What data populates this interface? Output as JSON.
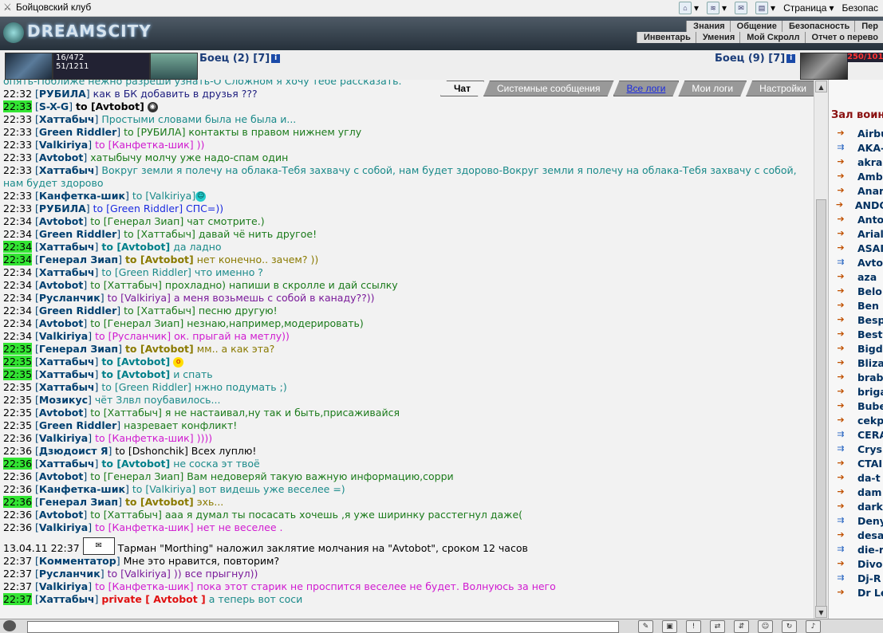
{
  "browser": {
    "title": "Бойцовский клуб",
    "toolbar": {
      "page_label": "Страница",
      "safety_label": "Безопас"
    }
  },
  "header": {
    "logo": "DREAMSCITY",
    "menu_top": [
      "Знания",
      "Общение",
      "Безопасность",
      "Пер"
    ],
    "menu_bottom": [
      "Инвентарь",
      "Умения",
      "Мой Скролл",
      "Отчет о перево"
    ]
  },
  "fight": {
    "my_hp": "16/472",
    "my_mana": "51/1211",
    "left_fighter": "Боец (2) [7]",
    "right_fighter": "Боец (9) [7]",
    "enemy_hp": "250/101"
  },
  "tabs": [
    "Чат",
    "Системные сообщения",
    "Все логи",
    "Мои логи",
    "Настройки"
  ],
  "colors": {
    "highlight_time": "#33e533",
    "nick": "#004070",
    "to": "#00808a",
    "teal": "#1a8a8a",
    "green": "#1a7a1a",
    "blue": "#1a2ae0",
    "magenta": "#d01ad0",
    "olive": "#8a7a00",
    "purple": "#7a1a9a",
    "black": "#000000",
    "navy": "#202080",
    "red": "#e01010"
  },
  "messages": [
    {
      "time": "",
      "nick": "",
      "to": "",
      "text": "опять-Поближе нежно разреши узнать-О Сложном я хочу тебе рассказать.",
      "color": "teal"
    },
    {
      "time": "22:32",
      "hl": false,
      "nick": "РУБИЛА",
      "to": "",
      "text": "как в БК добавить в друзья ???",
      "color": "navy"
    },
    {
      "time": "22:33",
      "hl": true,
      "nick": "S-X-G",
      "to": "to [Avtobot]",
      "to_black": true,
      "text": "",
      "color": "black",
      "emo": "alien"
    },
    {
      "time": "22:33",
      "hl": false,
      "nick": "Хаттабыч",
      "to": "",
      "text": "Простыми словами была не была и...",
      "color": "teal"
    },
    {
      "time": "22:33",
      "hl": false,
      "nick": "Green Riddler",
      "to": "",
      "text": "to [РУБИЛА] контакты в правом нижнем углу",
      "color": "green"
    },
    {
      "time": "22:33",
      "hl": false,
      "nick": "Valkiriya",
      "to": "",
      "text": "to [Канфетка-шик] ))",
      "color": "magenta"
    },
    {
      "time": "22:33",
      "hl": false,
      "nick": "Avtobot",
      "to": "",
      "text": "хатыбычу молчу уже надо-спам один",
      "color": "green"
    },
    {
      "time": "22:33",
      "hl": false,
      "nick": "Хаттабыч",
      "to": "",
      "text": "Вокруг земли я полечу на облака-Тебя захвачу с собой, нам будет здорово-Вокруг земли я полечу на облака-Тебя захвачу с собой, нам будет здорово",
      "color": "teal",
      "wrap": true
    },
    {
      "time": "22:33",
      "hl": false,
      "nick": "Канфетка-шик",
      "to": "",
      "text": "to [Valkiriya]",
      "color": "teal",
      "emo": "smile"
    },
    {
      "time": "22:33",
      "hl": false,
      "nick": "РУБИЛА",
      "to": "",
      "text": "to [Green Riddler] СПС=))",
      "color": "blue"
    },
    {
      "time": "22:34",
      "hl": false,
      "nick": "Avtobot",
      "to": "",
      "text": "to [Генерал Зиап] чат смотрите.)",
      "color": "green"
    },
    {
      "time": "22:34",
      "hl": false,
      "nick": "Green Riddler",
      "to": "",
      "text": "to [Хаттабыч] давай чё нить другое!",
      "color": "green"
    },
    {
      "time": "22:34",
      "hl": true,
      "nick": "Хаттабыч",
      "to": "to [Avtobot]",
      "text": "да ладно",
      "color": "teal"
    },
    {
      "time": "22:34",
      "hl": true,
      "nick": "Генерал Зиап",
      "to": "to [Avtobot]",
      "to_olive": true,
      "text": "нет конечно.. зачем? ))",
      "color": "olive"
    },
    {
      "time": "22:34",
      "hl": false,
      "nick": "Хаттабыч",
      "to": "",
      "text": "to [Green Riddler] что именно ?",
      "color": "teal"
    },
    {
      "time": "22:34",
      "hl": false,
      "nick": "Avtobot",
      "to": "",
      "text": "to [Хаттабыч] прохладно) напиши в скролле и дай ссылку",
      "color": "green"
    },
    {
      "time": "22:34",
      "hl": false,
      "nick": "Русланчик",
      "to": "",
      "text": "to [Valkiriya] а меня возьмешь с собой в канаду??))",
      "color": "purple"
    },
    {
      "time": "22:34",
      "hl": false,
      "nick": "Green Riddler",
      "to": "",
      "text": "to [Хаттабыч] песню другую!",
      "color": "green"
    },
    {
      "time": "22:34",
      "hl": false,
      "nick": "Avtobot",
      "to": "",
      "text": "to [Генерал Зиап] незнаю,например,модерировать)",
      "color": "green"
    },
    {
      "time": "22:34",
      "hl": false,
      "nick": "Valkiriya",
      "to": "",
      "text": "to [Русланчик] ок. прыгай на метлу))",
      "color": "magenta"
    },
    {
      "time": "22:35",
      "hl": true,
      "nick": "Генерал Зиап",
      "to": "to [Avtobot]",
      "to_olive": true,
      "text": "мм.. а как эта?",
      "color": "olive"
    },
    {
      "time": "22:35",
      "hl": true,
      "nick": "Хаттабыч",
      "to": "to [Avtobot]",
      "text": "",
      "color": "teal",
      "emo": "wow"
    },
    {
      "time": "22:35",
      "hl": true,
      "nick": "Хаттабыч",
      "to": "to [Avtobot]",
      "text": "и спать",
      "color": "teal"
    },
    {
      "time": "22:35",
      "hl": false,
      "nick": "Хаттабыч",
      "to": "",
      "text": "to [Green Riddler] нжно подумать ;)",
      "color": "teal"
    },
    {
      "time": "22:35",
      "hl": false,
      "nick": "Мозикус",
      "to": "",
      "text": "чёт Злвл поубавилось...",
      "color": "teal"
    },
    {
      "time": "22:35",
      "hl": false,
      "nick": "Avtobot",
      "to": "",
      "text": "to [Хаттабыч] я не настаивал,ну так и быть,присаживайся",
      "color": "green"
    },
    {
      "time": "22:35",
      "hl": false,
      "nick": "Green Riddler",
      "to": "",
      "text": "назревает конфликт!",
      "color": "green"
    },
    {
      "time": "22:36",
      "hl": false,
      "nick": "Valkiriya",
      "to": "",
      "text": "to [Канфетка-шик] ))))",
      "color": "magenta"
    },
    {
      "time": "22:36",
      "hl": false,
      "nick": "Дзюдоист Я",
      "to": "",
      "text": "to [Dshonchik] Всех луплю!",
      "color": "black"
    },
    {
      "time": "22:36",
      "hl": true,
      "nick": "Хаттабыч",
      "to": "to [Avtobot]",
      "text": "не соска эт твоё",
      "color": "teal"
    },
    {
      "time": "22:36",
      "hl": false,
      "nick": "Avtobot",
      "to": "",
      "text": "to [Генерал Зиап] Вам недоверяй такую важную информацию,сорри",
      "color": "green"
    },
    {
      "time": "22:36",
      "hl": false,
      "nick": "Канфетка-шик",
      "to": "",
      "text": "to [Valkiriya] вот видешь уже веселее =)",
      "color": "teal"
    },
    {
      "time": "22:36",
      "hl": true,
      "nick": "Генерал Зиап",
      "to": "to [Avtobot]",
      "to_olive": true,
      "text": "эхь...",
      "color": "olive"
    },
    {
      "time": "22:36",
      "hl": false,
      "nick": "Avtobot",
      "to": "",
      "text": "to [Хаттабыч] ааа я думал ты посасать хочешь ,я уже ширинку расстегнул даже(",
      "color": "green"
    },
    {
      "time": "22:36",
      "hl": false,
      "nick": "Valkiriya",
      "to": "",
      "text": "to [Канфетка-шик] нет не веселее .",
      "color": "magenta"
    },
    {
      "system": true,
      "date": "13.04.11 22:37",
      "text": "Тарман \"Morthing\" наложил заклятие молчания на \"Avtobot\", сроком 12 часов"
    },
    {
      "time": "22:37",
      "hl": false,
      "nick": "Комментатор",
      "to": "",
      "text": "Мне это нравится, повторим?",
      "color": "black"
    },
    {
      "time": "22:37",
      "hl": false,
      "nick": "Русланчик",
      "to": "",
      "text": "to [Valkiriya] )) все прыгнул))",
      "color": "purple"
    },
    {
      "time": "22:37",
      "hl": false,
      "nick": "Valkiriya",
      "to": "",
      "text": "to [Канфетка-шик] пока этот старик не проспится веселее не будет. Волнуюсь за него",
      "color": "magenta"
    },
    {
      "time": "22:37",
      "hl": true,
      "nick": "Хаттабыч",
      "to": "private [ Avtobot ]",
      "to_red": true,
      "text": "а теперь вот соси",
      "color": "teal"
    }
  ],
  "room": {
    "title": "Зал воин",
    "users": [
      {
        "name": "Airbu",
        "icon": "o"
      },
      {
        "name": "AKA-",
        "icon": "b"
      },
      {
        "name": "akra",
        "icon": "o"
      },
      {
        "name": "Amb",
        "icon": "o"
      },
      {
        "name": "Anar",
        "icon": "o"
      },
      {
        "name": "ANDO",
        "icon": "o"
      },
      {
        "name": "Anto",
        "icon": "o"
      },
      {
        "name": "Arial",
        "icon": "o"
      },
      {
        "name": "ASAI",
        "icon": "o"
      },
      {
        "name": "Avto",
        "icon": "b"
      },
      {
        "name": "aza",
        "icon": "o"
      },
      {
        "name": "Belo",
        "icon": "o"
      },
      {
        "name": "Ben",
        "icon": "o"
      },
      {
        "name": "Besp",
        "icon": "o"
      },
      {
        "name": "Best",
        "icon": "o"
      },
      {
        "name": "Bigd",
        "icon": "o"
      },
      {
        "name": "Bliza",
        "icon": "o"
      },
      {
        "name": "brab",
        "icon": "o"
      },
      {
        "name": "briga",
        "icon": "o"
      },
      {
        "name": "Bube",
        "icon": "o"
      },
      {
        "name": "cekp",
        "icon": "o"
      },
      {
        "name": "CERA",
        "icon": "b"
      },
      {
        "name": "Crys",
        "icon": "b"
      },
      {
        "name": "CTAI",
        "icon": "o"
      },
      {
        "name": "da-t",
        "icon": "o"
      },
      {
        "name": "dam",
        "icon": "o"
      },
      {
        "name": "dark",
        "icon": "o"
      },
      {
        "name": "Deny",
        "icon": "b"
      },
      {
        "name": "desa",
        "icon": "o"
      },
      {
        "name": "die-r",
        "icon": "b"
      },
      {
        "name": "Divo",
        "icon": "o"
      },
      {
        "name": "Dj-R",
        "icon": "b"
      },
      {
        "name": "Dr Le",
        "icon": "o"
      }
    ]
  }
}
